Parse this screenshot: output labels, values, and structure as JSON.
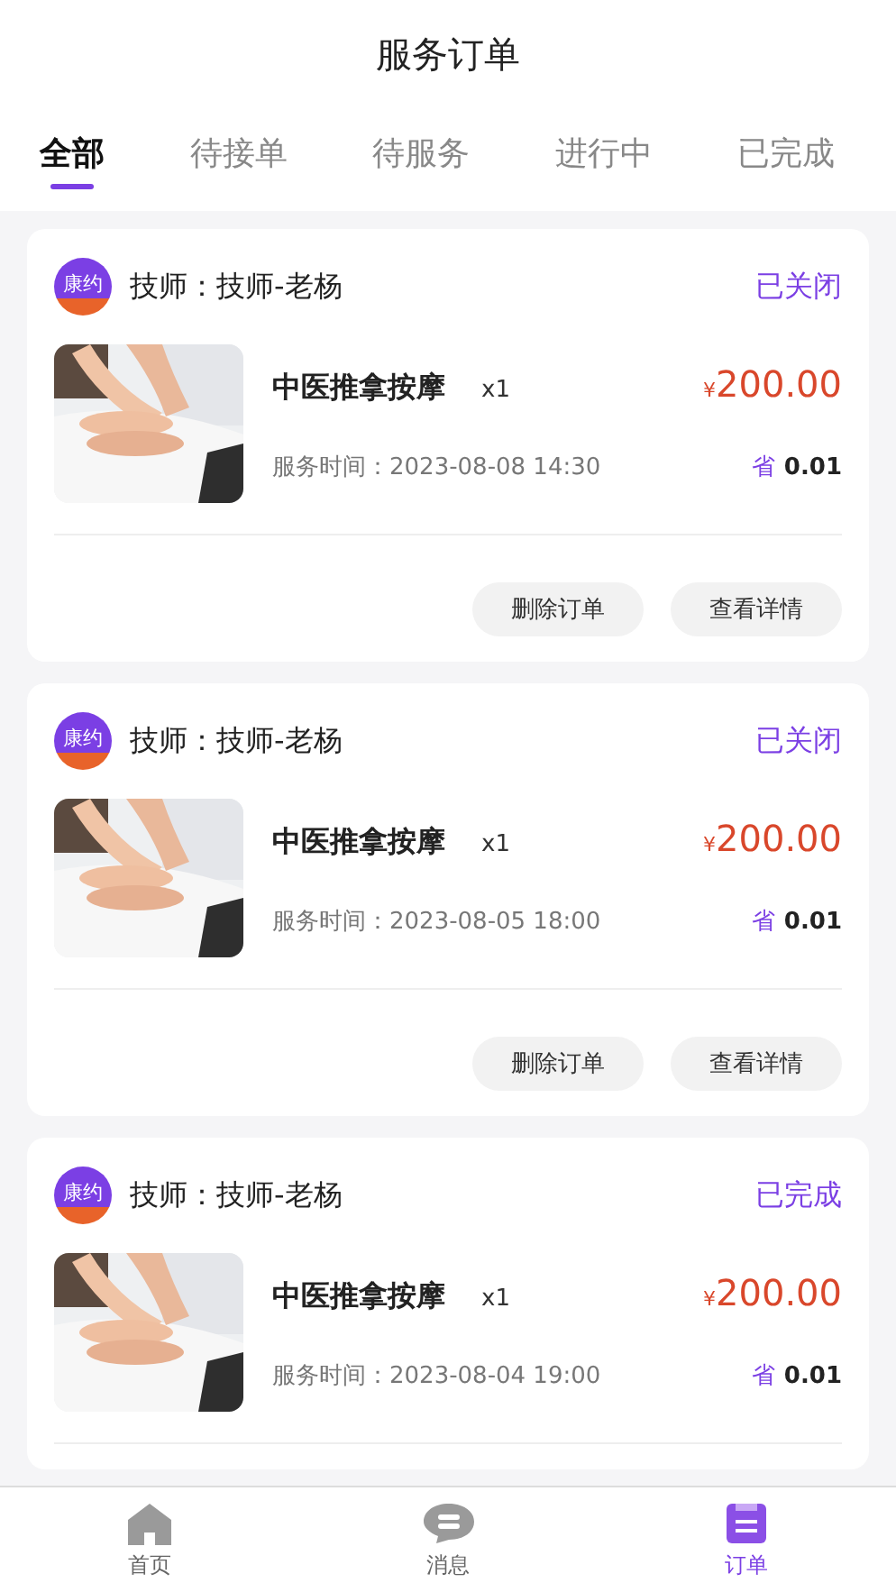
{
  "header": {
    "title": "服务订单"
  },
  "tabs": [
    {
      "label": "全部",
      "selected": true
    },
    {
      "label": "待接单",
      "selected": false
    },
    {
      "label": "待服务",
      "selected": false
    },
    {
      "label": "进行中",
      "selected": false
    },
    {
      "label": "已完成",
      "selected": false
    }
  ],
  "orders": [
    {
      "logo": "康约",
      "technician": "技师：技师-老杨",
      "status": "已关闭",
      "image": {
        "kind": "picture"
      },
      "service": "中医推拿按摩",
      "quantity": "x1",
      "currency": "¥",
      "price": "200.00",
      "time": "服务时间：2023-08-08 14:30",
      "save_label": "省",
      "save_amount": "0.01",
      "actions": [
        "删除订单",
        "查看详情"
      ]
    },
    {
      "logo": "康约",
      "technician": "技师：技师-老杨",
      "status": "已关闭",
      "image": {
        "kind": "picture"
      },
      "service": "中医推拿按摩",
      "quantity": "x1",
      "currency": "¥",
      "price": "200.00",
      "time": "服务时间：2023-08-05 18:00",
      "save_label": "省",
      "save_amount": "0.01",
      "actions": [
        "删除订单",
        "查看详情"
      ]
    },
    {
      "logo": "康约",
      "technician": "技师：技师-老杨",
      "status": "已完成",
      "image": {
        "kind": "picture"
      },
      "service": "中医推拿按摩",
      "quantity": "x1",
      "currency": "¥",
      "price": "200.00",
      "time": "服务时间：2023-08-04 19:00",
      "save_label": "省",
      "save_amount": "0.01"
    }
  ],
  "bottom_nav": [
    {
      "label": "首页",
      "kind": "home",
      "selected": false
    },
    {
      "label": "消息",
      "kind": "message",
      "selected": false
    },
    {
      "label": "订单",
      "kind": "order",
      "selected": true
    }
  ]
}
